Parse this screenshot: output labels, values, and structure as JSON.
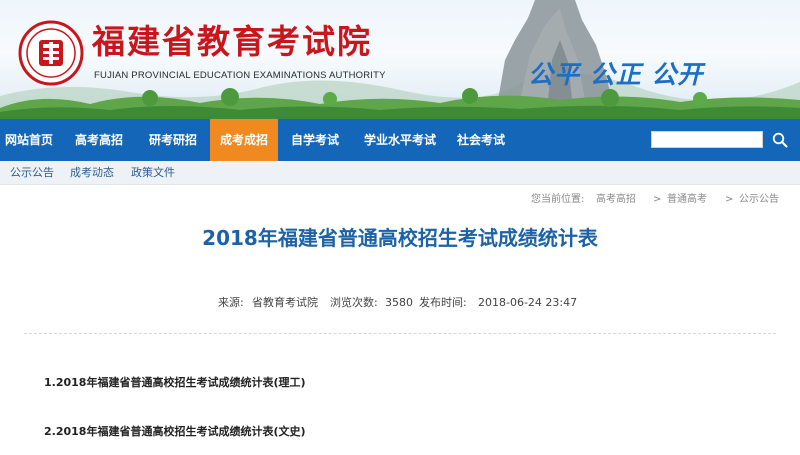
{
  "header": {
    "title": "福建省教育考试院",
    "subtitle": "FUJIAN PROVINCIAL EDUCATION EXAMINATIONS AUTHORITY",
    "slogan": "公平 公正 公开",
    "accent_red": "#c8161d",
    "brand_blue": "#1467b8"
  },
  "nav": {
    "items": [
      {
        "label": "网站首页"
      },
      {
        "label": "高考高招"
      },
      {
        "label": "研考研招"
      },
      {
        "label": "成考成招",
        "active": true
      },
      {
        "label": "自学考试"
      },
      {
        "label": "学业水平考试"
      },
      {
        "label": "社会考试"
      }
    ],
    "active_color": "#f08a20",
    "search": {
      "value": "",
      "icon": "search-icon"
    }
  },
  "subnav": {
    "items": [
      {
        "label": "公示公告"
      },
      {
        "label": "成考动态"
      },
      {
        "label": "政策文件"
      }
    ]
  },
  "breadcrumb": {
    "prefix": "您当前位置:",
    "items": [
      "高考高招",
      "普通高考",
      "公示公告"
    ],
    "separator": ">"
  },
  "article": {
    "title": "2018年福建省普通高校招生考试成绩统计表",
    "meta": {
      "source_label": "来源:",
      "source": "省教育考试院",
      "views_label": "浏览次数:",
      "views": "3580",
      "time_label": "发布时间:",
      "time": "2018-06-24 23:47"
    },
    "documents": [
      {
        "label": "1.2018年福建省普通高校招生考试成绩统计表(理工)"
      },
      {
        "label": "2.2018年福建省普通高校招生考试成绩统计表(文史)"
      }
    ]
  }
}
